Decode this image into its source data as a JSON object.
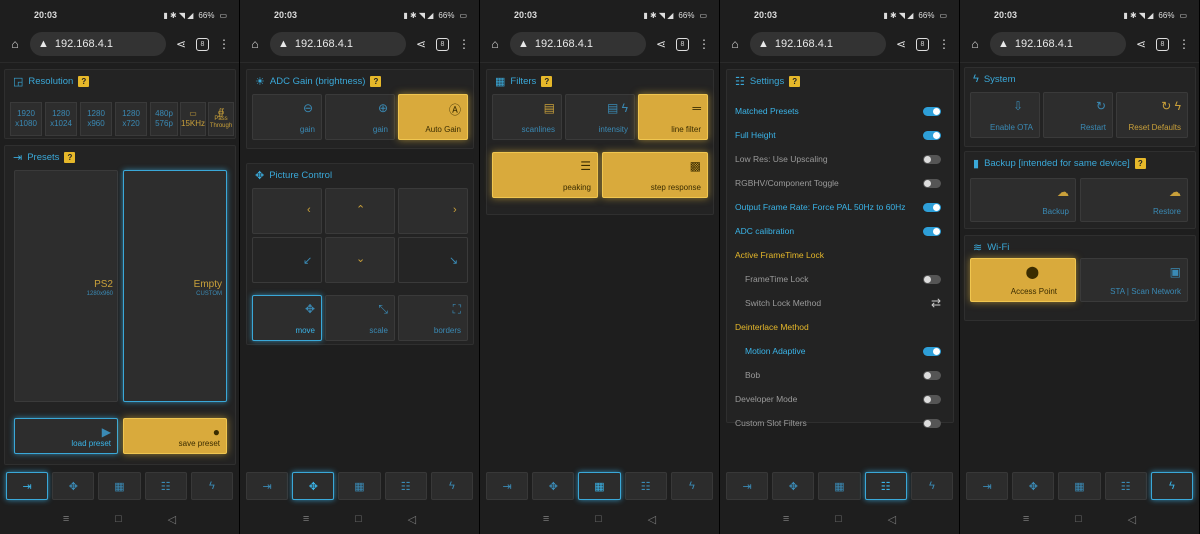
{
  "status": {
    "time": "20:03",
    "battery": "66%"
  },
  "browser": {
    "url": "192.168.4.1",
    "tabs": "8"
  },
  "nav_icons": [
    "input-icon",
    "move-icon",
    "filter-icon",
    "settings-icon",
    "system-icon"
  ],
  "panel1": {
    "resolution": {
      "title": "Resolution",
      "help": "?",
      "items": [
        {
          "l1": "1920",
          "l2": "x1080"
        },
        {
          "l1": "1280",
          "l2": "x1024"
        },
        {
          "l1": "1280",
          "l2": "x960"
        },
        {
          "l1": "1280",
          "l2": "x720"
        },
        {
          "l1": "480p",
          "l2": "576p"
        },
        {
          "l1": "15KHz",
          "l2": ""
        },
        {
          "l1": "Pass",
          "l2": "Through"
        }
      ]
    },
    "presets": {
      "title": "Presets",
      "help": "?",
      "slot1": {
        "name": "PS2",
        "sub": "1280x960"
      },
      "slot2": {
        "name": "Empty",
        "sub": "CUSTOM"
      },
      "load": "load preset",
      "save": "save preset"
    }
  },
  "panel2": {
    "adc": {
      "title": "ADC Gain (brightness)",
      "help": "?",
      "minus": "gain",
      "plus": "gain",
      "auto": "Auto Gain"
    },
    "picture": {
      "title": "Picture Control",
      "move": "move",
      "scale": "scale",
      "borders": "borders"
    }
  },
  "panel3": {
    "filters": {
      "title": "Filters",
      "help": "?",
      "scanlines": "scanlines",
      "intensity": "intensity",
      "line": "line filter",
      "peaking": "peaking",
      "step": "step response"
    }
  },
  "panel4": {
    "settings": {
      "title": "Settings",
      "help": "?",
      "rows": [
        {
          "label": "Matched Presets",
          "state": "on",
          "style": "blue"
        },
        {
          "label": "Full Height",
          "state": "on",
          "style": "blue"
        },
        {
          "label": "Low Res: Use Upscaling",
          "state": "off",
          "style": "gray"
        },
        {
          "label": "RGBHV/Component Toggle",
          "state": "off",
          "style": "gray"
        },
        {
          "label": "Output Frame Rate: Force PAL 50Hz to 60Hz",
          "state": "on",
          "style": "blue"
        },
        {
          "label": "ADC calibration",
          "state": "on",
          "style": "blue"
        },
        {
          "label": "Active FrameTime Lock",
          "state": "none",
          "style": "yel"
        },
        {
          "label": "FrameTime Lock",
          "state": "off",
          "style": "gray ind"
        },
        {
          "label": "Switch Lock Method",
          "state": "swap",
          "style": "gray ind"
        },
        {
          "label": "Deinterlace Method",
          "state": "none",
          "style": "yel"
        },
        {
          "label": "Motion Adaptive",
          "state": "on",
          "style": "blue ind"
        },
        {
          "label": "Bob",
          "state": "off",
          "style": "gray ind"
        },
        {
          "label": "Developer Mode",
          "state": "off",
          "style": "gray"
        },
        {
          "label": "Custom Slot Filters",
          "state": "off",
          "style": "gray"
        }
      ]
    }
  },
  "panel5": {
    "system": {
      "title": "System",
      "ota": "Enable OTA",
      "restart": "Restart",
      "reset": "Reset Defaults"
    },
    "backup": {
      "title": "Backup [intended for same device]",
      "help": "?",
      "backup": "Backup",
      "restore": "Restore"
    },
    "wifi": {
      "title": "Wi-Fi",
      "ap": "Access Point",
      "sta": "STA | Scan Network"
    }
  }
}
